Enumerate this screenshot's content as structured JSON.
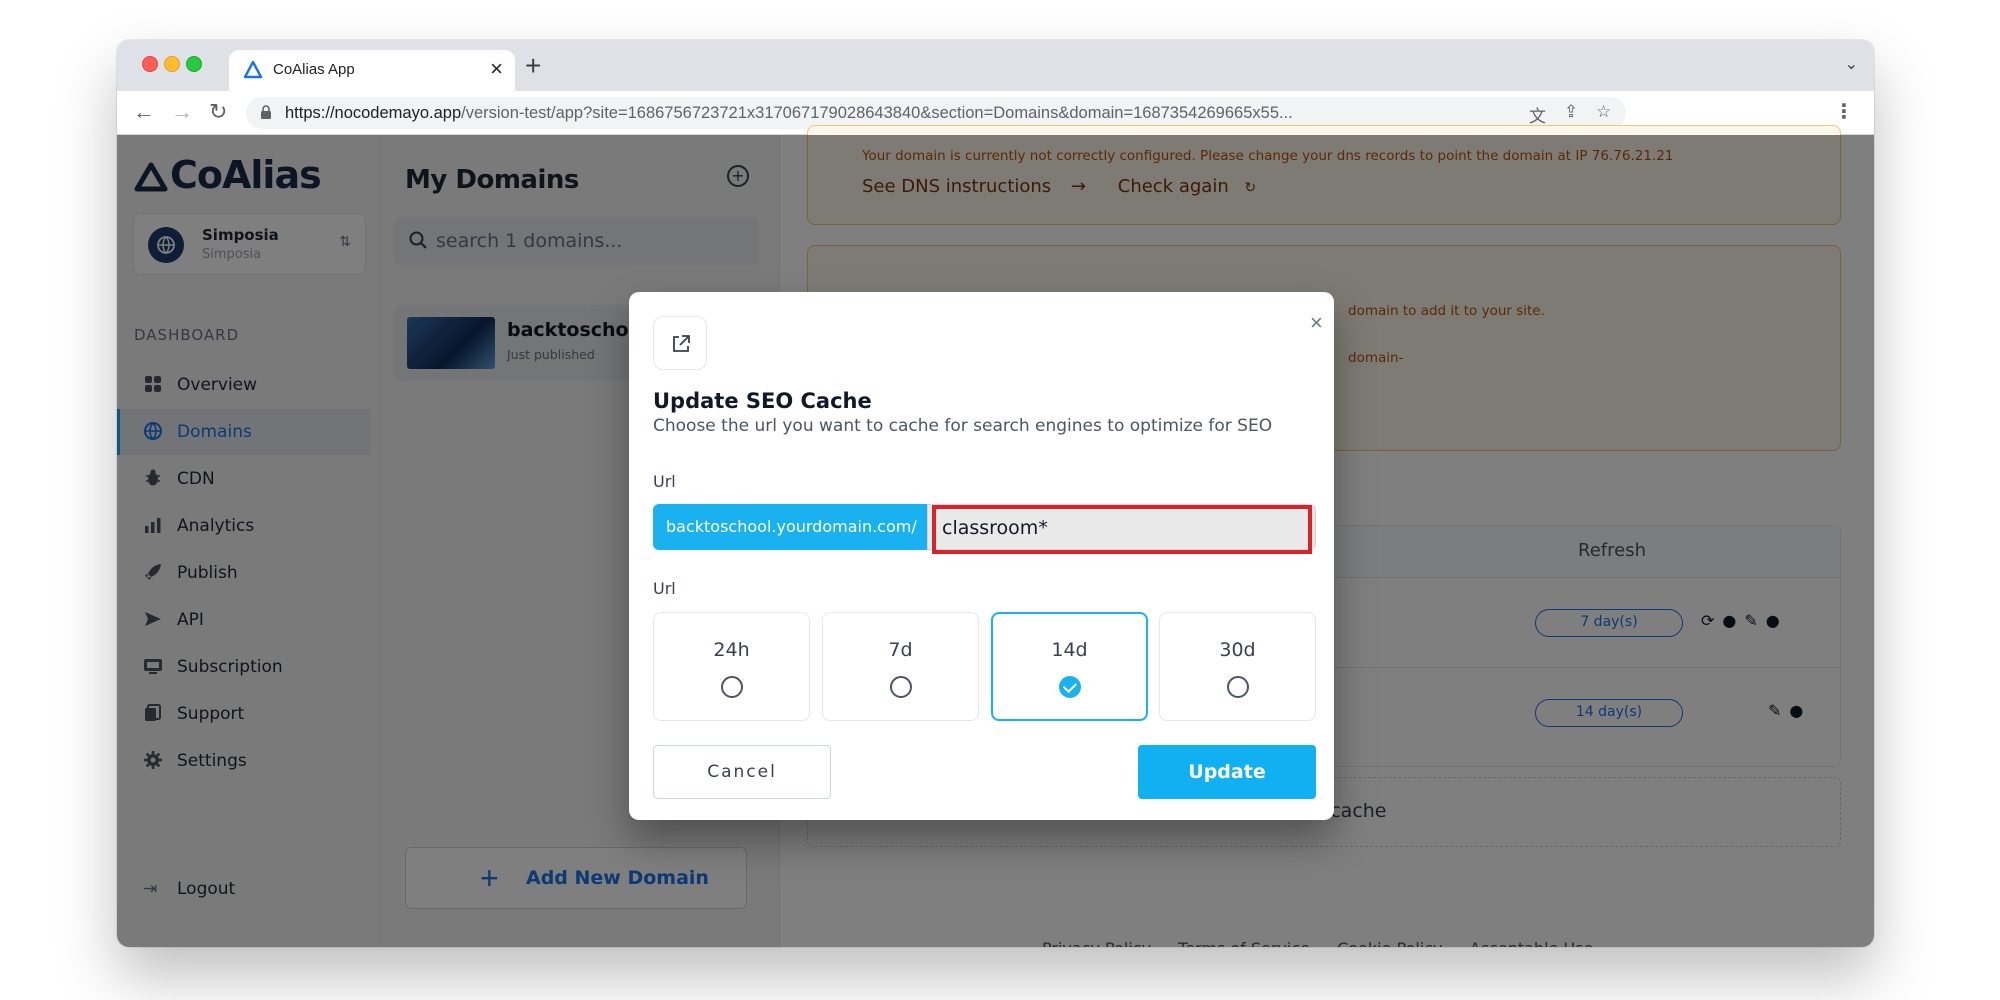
{
  "browser": {
    "tab_title": "CoAlias App",
    "tab_close": "×",
    "new_tab": "+",
    "url_host": "https://nocodemayo.app",
    "url_path": "/version-test/app?site=1686756723721x317067179028643840&section=Domains&domain=1687354269665x55..."
  },
  "sidebar": {
    "logo": "CoAlias",
    "workspace_name": "Simposia",
    "workspace_sub": "Simposia",
    "section_label": "DASHBOARD",
    "items": [
      {
        "label": "Overview",
        "icon": "grid-icon"
      },
      {
        "label": "Domains",
        "icon": "globe-icon"
      },
      {
        "label": "CDN",
        "icon": "bug-icon"
      },
      {
        "label": "Analytics",
        "icon": "bar-chart-icon"
      },
      {
        "label": "Publish",
        "icon": "rocket-icon"
      },
      {
        "label": "API",
        "icon": "send-icon"
      },
      {
        "label": "Subscription",
        "icon": "card-icon"
      },
      {
        "label": "Support",
        "icon": "docs-icon"
      },
      {
        "label": "Settings",
        "icon": "gear-icon"
      }
    ],
    "logout": "Logout"
  },
  "domains_panel": {
    "title": "My Domains",
    "search_placeholder": "search 1 domains...",
    "card_title": "backtoschool",
    "card_sub": "Just published",
    "add_button": "Add New Domain"
  },
  "main": {
    "warning_text": "Your domain is currently not correctly configured. Please change your dns records to point the domain at IP 76.76.21.21",
    "see_dns": "See DNS instructions",
    "check_again": "Check again",
    "warning2_a": "domain to add it to your site.",
    "warning2_b": "domain-",
    "refresh_header": "Refresh",
    "row1_badge": "7 day(s)",
    "row2_badge": "14 day(s)",
    "add_cache": "Add cache",
    "footer": [
      "Privacy Policy",
      "Terms of Service",
      "Cookie Policy",
      "Acceptable Use"
    ]
  },
  "modal": {
    "title": "Update SEO Cache",
    "subtitle": "Choose the url you want to cache for search engines to optimize for SEO",
    "url_label": "Url",
    "prefix": "backtoschool.yourdomain.com/",
    "input_value": "classroom*",
    "url_label_2": "Url",
    "options": [
      {
        "label": "24h",
        "selected": false
      },
      {
        "label": "7d",
        "selected": false
      },
      {
        "label": "14d",
        "selected": true
      },
      {
        "label": "30d",
        "selected": false
      }
    ],
    "cancel": "Cancel",
    "update": "Update",
    "close": "×"
  },
  "colors": {
    "accent": "#1ab1f0",
    "link": "#1a73e8",
    "warning_bg": "#fdf6ea",
    "highlight": "#d62429"
  }
}
